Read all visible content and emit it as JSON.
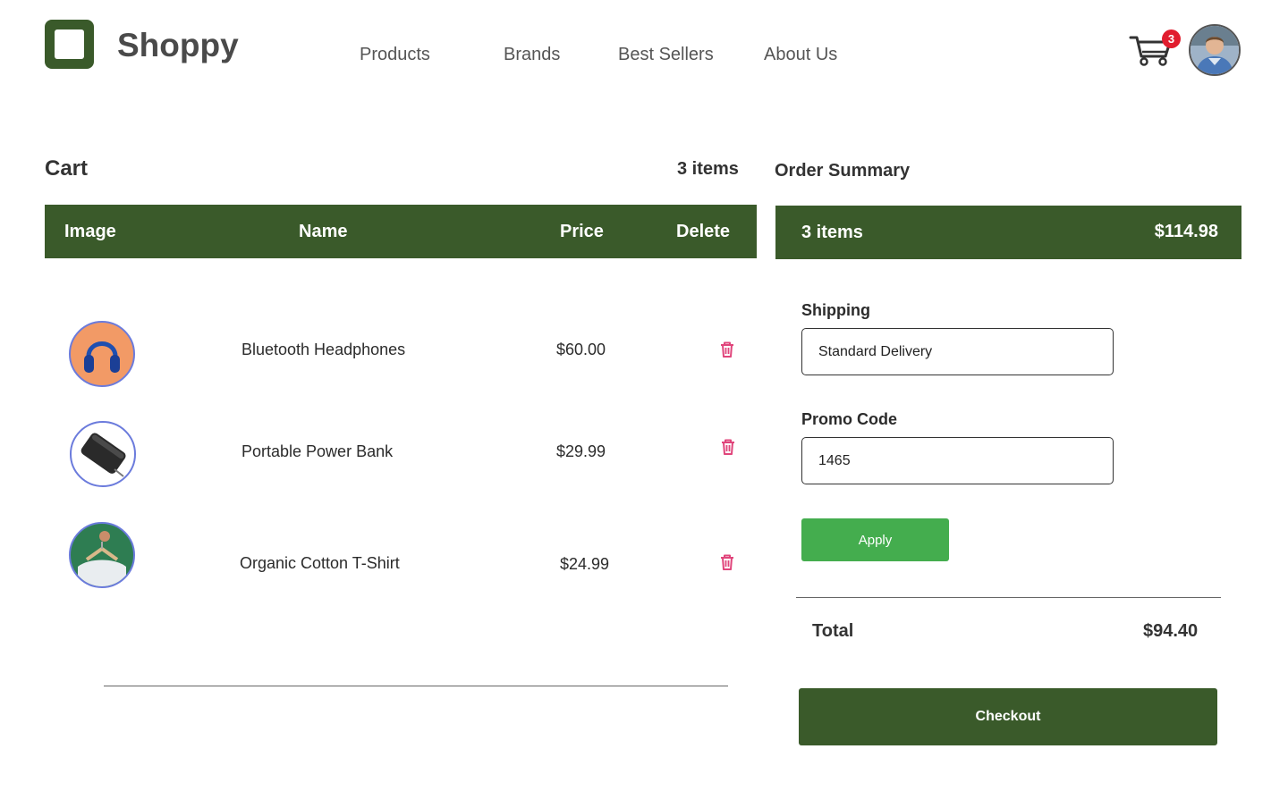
{
  "header": {
    "brand": "Shoppy",
    "nav": [
      "Products",
      "Brands",
      "Best Sellers",
      "About Us"
    ],
    "cart_badge": "3"
  },
  "cart": {
    "title": "Cart",
    "count": "3 items",
    "columns": [
      "Image",
      "Name",
      "Price",
      "Delete"
    ],
    "items": [
      {
        "name": "Bluetooth Headphones",
        "price": "$60.00",
        "image_icon": "headphones-icon"
      },
      {
        "name": "Portable Power Bank",
        "price": "$29.99",
        "image_icon": "power-bank-icon"
      },
      {
        "name": "Organic Cotton T-Shirt",
        "price": "$24.99",
        "image_icon": "tshirt-icon"
      }
    ]
  },
  "summary": {
    "title": "Order Summary",
    "items_label": "3 items",
    "subtotal": "$114.98",
    "shipping_label": "Shipping",
    "shipping_value": "Standard Delivery",
    "promo_label": "Promo Code",
    "promo_value": "1465",
    "apply_label": "Apply",
    "total_label": "Total",
    "total_value": "$94.40",
    "checkout_label": "Checkout"
  },
  "colors": {
    "primary": "#3a5a2a",
    "apply": "#44ad4e",
    "badge": "#e11d2e",
    "delete": "#e0457b",
    "thumb_border": "#6b7bdc"
  }
}
